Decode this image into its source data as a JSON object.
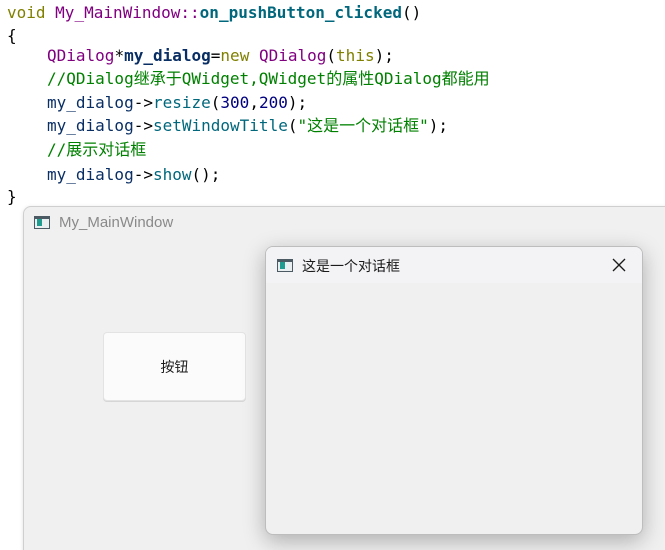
{
  "code": {
    "line1": {
      "kw": "void",
      "cls": "My_MainWindow",
      "sep": "::",
      "fn": "on_pushButton_clicked",
      "parens": "()"
    },
    "line2": {
      "brace": "{"
    },
    "line3": {
      "type": "QDialog",
      "star": "*",
      "var": "my_dialog",
      "eq": "=",
      "kw_new": "new",
      "type2": "QDialog",
      "open": "(",
      "kw_this": "this",
      "close": ");"
    },
    "line4": {
      "comment": "//QDialog继承于QWidget,QWidget的属性QDialog都能用"
    },
    "line5": {
      "obj": "my_dialog",
      "arrow": "->",
      "method": "resize",
      "open": "(",
      "num1": "300",
      "comma": ",",
      "num2": "200",
      "close": ");"
    },
    "line6": {
      "obj": "my_dialog",
      "arrow": "->",
      "method": "setWindowTitle",
      "open": "(",
      "str": "\"这是一个对话框\"",
      "close": ");"
    },
    "line7": {
      "comment": "//展示对话框"
    },
    "line8": {
      "obj": "my_dialog",
      "arrow": "->",
      "method": "show",
      "close": "();"
    },
    "line9": {
      "brace": "}"
    }
  },
  "main_window": {
    "title": "My_MainWindow",
    "button_label": "按钮"
  },
  "dialog": {
    "title": "这是一个对话框"
  },
  "icons": {
    "app": "qt-app-icon",
    "close": "close-icon"
  },
  "colors": {
    "keyword": "#808000",
    "type": "#800080",
    "function": "#00677c",
    "variable": "#092e64",
    "comment": "#008000",
    "string": "#008000",
    "number": "#000080",
    "window_bg": "#f0f0f0"
  }
}
